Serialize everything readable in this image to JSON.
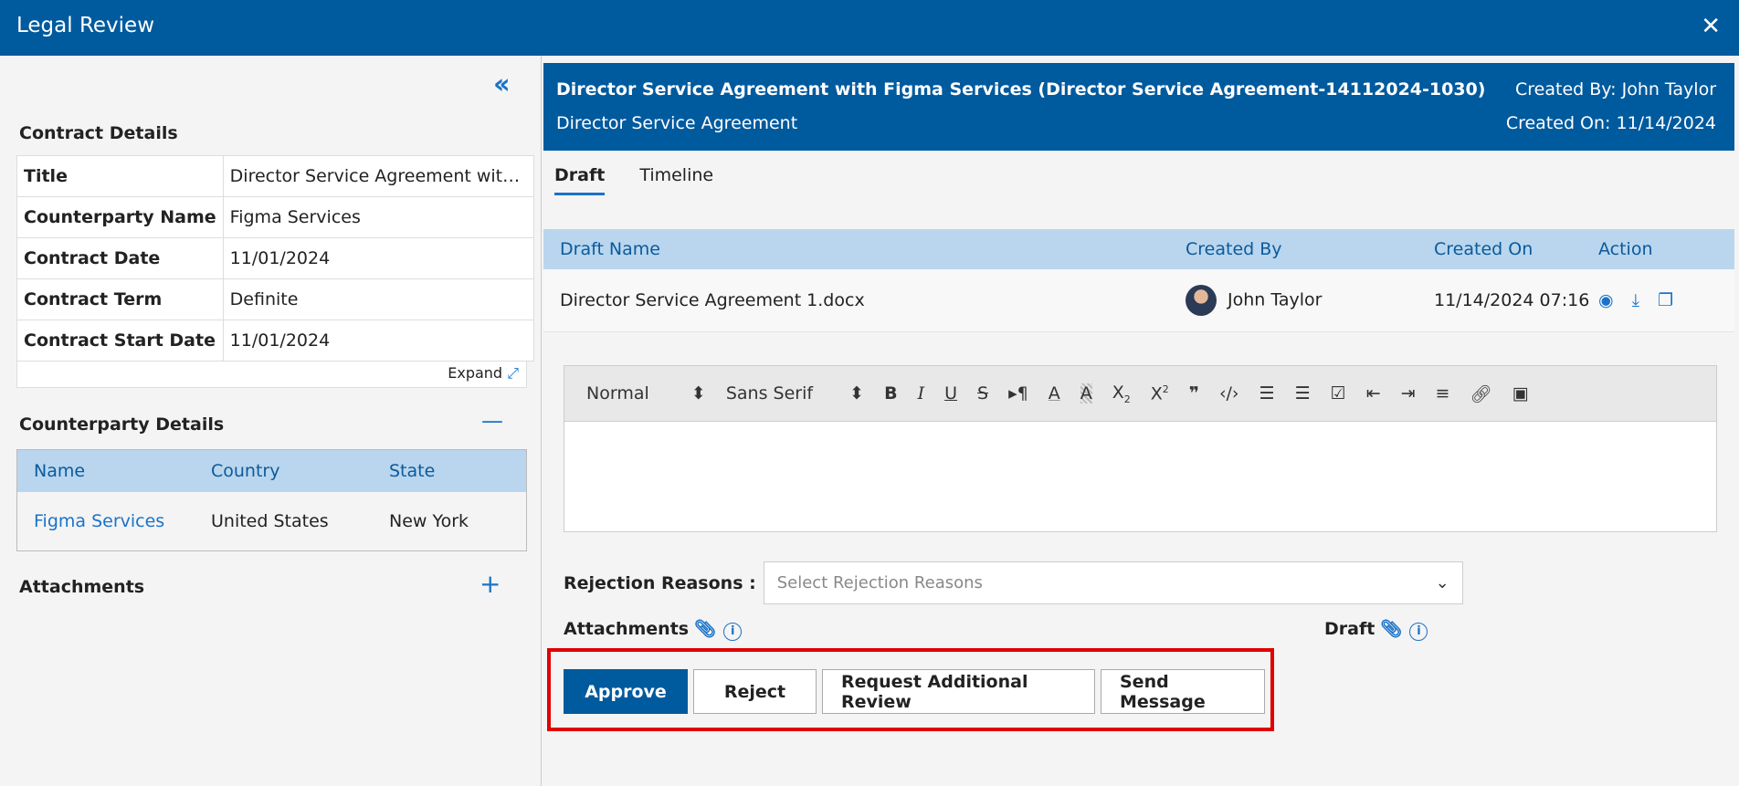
{
  "window": {
    "title": "Legal Review"
  },
  "left": {
    "contract_details_title": "Contract Details",
    "contract_details": [
      {
        "label": "Title",
        "value": "Director Service Agreement with ..."
      },
      {
        "label": "Counterparty Name",
        "value": "Figma Services"
      },
      {
        "label": "Contract Date",
        "value": "11/01/2024"
      },
      {
        "label": "Contract Term",
        "value": "Definite"
      },
      {
        "label": "Contract Start Date",
        "value": "11/01/2024"
      }
    ],
    "expand_label": "Expand",
    "counterparty_title": "Counterparty Details",
    "counterparty_headers": [
      "Name",
      "Country",
      "State"
    ],
    "counterparty_rows": [
      [
        "Figma Services",
        "United States",
        "New York"
      ]
    ],
    "attachments_title": "Attachments"
  },
  "header": {
    "title": "Director Service Agreement with Figma Services (Director Service Agreement-14112024-1030)",
    "subtitle": "Director Service Agreement",
    "created_by": "Created By: John Taylor",
    "created_on": "Created On: 11/14/2024"
  },
  "tabs": [
    "Draft",
    "Timeline"
  ],
  "drafts": {
    "headers": [
      "Draft Name",
      "Created By",
      "Created On",
      "Action"
    ],
    "rows": [
      {
        "name": "Director Service Agreement 1.docx",
        "created_by": "John Taylor",
        "created_on": "11/14/2024 07:16"
      }
    ]
  },
  "editor": {
    "format": "Normal",
    "font": "Sans Serif"
  },
  "rejection": {
    "label": "Rejection Reasons :",
    "placeholder": "Select Rejection Reasons"
  },
  "attachments_label": "Attachments",
  "draft_label": "Draft",
  "buttons": {
    "approve": "Approve",
    "reject": "Reject",
    "request_review": "Request Additional Review",
    "send_message": "Send Message"
  },
  "colors": {
    "brand": "#005a9e",
    "highlight": "#e00000"
  }
}
